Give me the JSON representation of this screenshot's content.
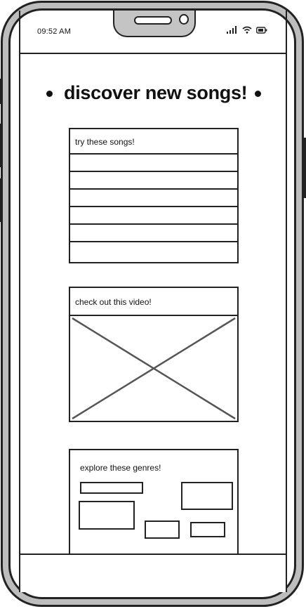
{
  "status_bar": {
    "time": "09:52 AM",
    "icons": [
      "signal-icon",
      "wifi-icon",
      "battery-icon"
    ]
  },
  "page": {
    "heading": "discover new songs!"
  },
  "songs_card": {
    "title": "try these songs!",
    "rows": 6
  },
  "video_card": {
    "title": "check out this video!",
    "media": "video-placeholder"
  },
  "genres_card": {
    "title": "explore these genres!",
    "chips": 5
  },
  "colors": {
    "ink": "#222222",
    "frame_fill": "#bdbdbd",
    "screen_bg": "#ffffff"
  }
}
